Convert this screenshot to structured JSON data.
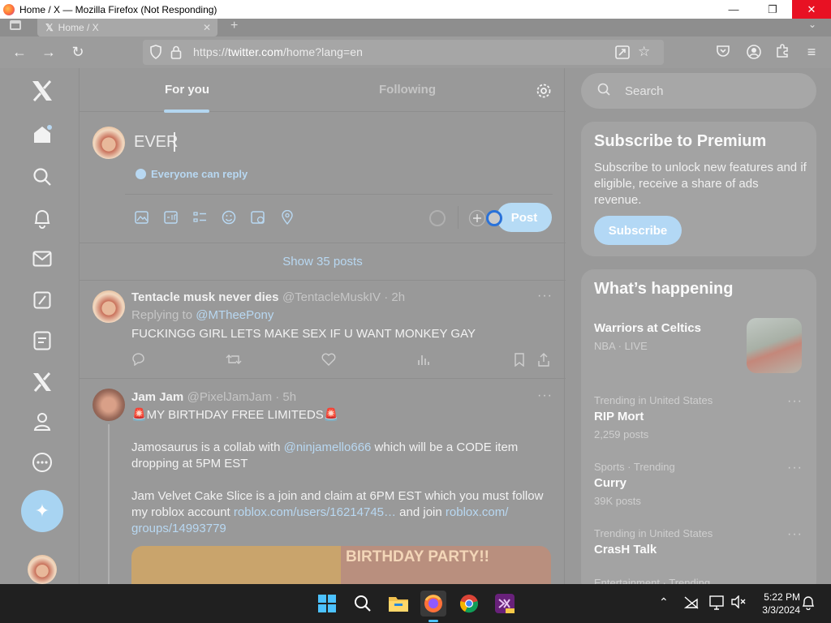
{
  "window": {
    "title": "Home / X — Mozilla Firefox (Not Responding)",
    "minimize_icon": "minimize-icon",
    "maximize_icon": "maximize-icon",
    "close_icon": "close-icon"
  },
  "browser": {
    "tab_title": "Home / X",
    "url_scheme": "https://",
    "url_host": "twitter.com",
    "url_path": "/home?lang=en"
  },
  "timeline": {
    "tabs": [
      {
        "label": "For you"
      },
      {
        "label": "Following"
      }
    ],
    "composer": {
      "text": "EVER",
      "reply_setting": "Everyone can reply",
      "post_label": "Post"
    },
    "show_posts": "Show 35 posts",
    "tweets": [
      {
        "name": "Tentacle musk never dies",
        "handle": "@TentacleMuskIV · 2h",
        "replying_prefix": "Replying to ",
        "replying_to": "@MTheePony",
        "text": "FUCKINGG GIRL LETS MAKE SEX IF U WANT MONKEY GAY"
      },
      {
        "name": "Jam Jam",
        "handle": "@PixelJamJam · 5h",
        "line1": "🚨MY BIRTHDAY FREE LIMITEDS🚨",
        "line2_prefix": "Jamosaurus is a collab with ",
        "line2_link": "@ninjamello666",
        "line2_suffix": " which will be a CODE item",
        "line3": "dropping at 5PM EST",
        "line4": "Jam Velvet Cake Slice is a join and claim at 6PM EST which you must follow",
        "line5_prefix": "my roblox account ",
        "line5_link": "roblox.com/users/16214745…",
        "line5_mid": " and join ",
        "line5_link2": "roblox.com/",
        "line6_link": "groups/14993779",
        "image_text": "BIRTHDAY PARTY!!"
      }
    ]
  },
  "sidebar": {
    "search_placeholder": "Search",
    "premium": {
      "title": "Subscribe to Premium",
      "body": "Subscribe to unlock new features and if eligible, receive a share of ads revenue.",
      "button": "Subscribe"
    },
    "happening": {
      "title": "What’s happening",
      "event_title": "Warriors at Celtics",
      "event_meta": "NBA · LIVE",
      "trends": [
        {
          "meta": "Trending in United States",
          "name": "RIP Mort",
          "count": "2,259 posts"
        },
        {
          "meta": "Sports · Trending",
          "name": "Curry",
          "count": "39K posts"
        },
        {
          "meta": "Trending in United States",
          "name": "CrasH Talk",
          "count": ""
        },
        {
          "meta": "Entertainment · Trending",
          "name": "",
          "count": ""
        }
      ]
    }
  },
  "taskbar": {
    "time": "5:22 PM",
    "date": "3/3/2024"
  },
  "colors": {
    "accent": "#1d9bf0",
    "close_red": "#e81123",
    "taskbar": "#202020"
  }
}
